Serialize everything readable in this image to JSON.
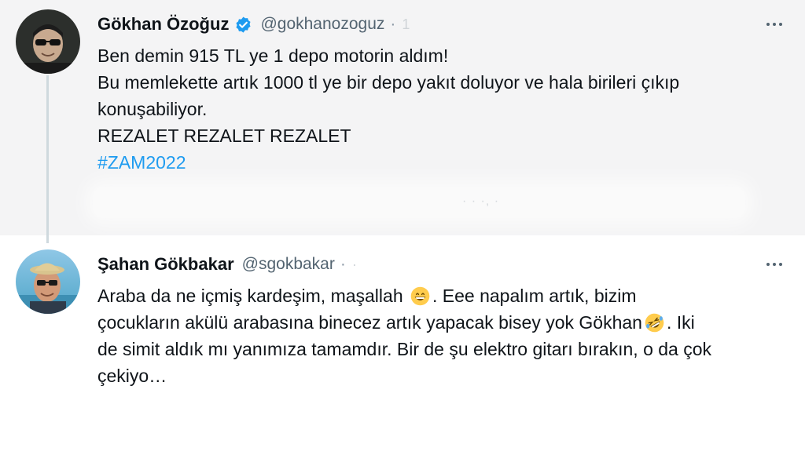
{
  "tweet1": {
    "author_name": "Gökhan Özoğuz",
    "handle": "@gokhanozoguz",
    "separator": "·",
    "faded_time": "1",
    "verified": true,
    "lines": [
      "Ben demin  915 TL ye 1 depo motorin aldım!",
      "Bu memlekette artık 1000 tl ye bir depo yakıt doluyor ve hala birileri çıkıp",
      "konuşabiliyor.",
      "REZALET REZALET REZALET"
    ],
    "hashtag": "#ZAM2022",
    "blurred_meta": "·  ·  ·, ·"
  },
  "tweet2": {
    "author_name": "Şahan Gökbakar",
    "handle": "@sgokbakar",
    "separator": "·",
    "faded_time": "·",
    "line1_a": "Araba da ne içmiş kardeşim, maşallah",
    "line1_b": ". Eee napalım artık, bizim",
    "line2_a": "çocukların  akülü arabasına binecez artık yapacak bisey yok Gökhan",
    "line2_b": ". Iki",
    "line3": "de simit aldık mı yanımıza tamamdır. Bir de şu elektro gitarı bırakın, o da çok",
    "line4": "çekiyo…",
    "emoji_1": "grinning-face-emoji",
    "emoji_2": "rofl-emoji"
  },
  "colors": {
    "hashtag": "#1d9bf0",
    "verified": "#1d9bf0",
    "handle": "#536471",
    "thread_line": "#cfd9de"
  }
}
